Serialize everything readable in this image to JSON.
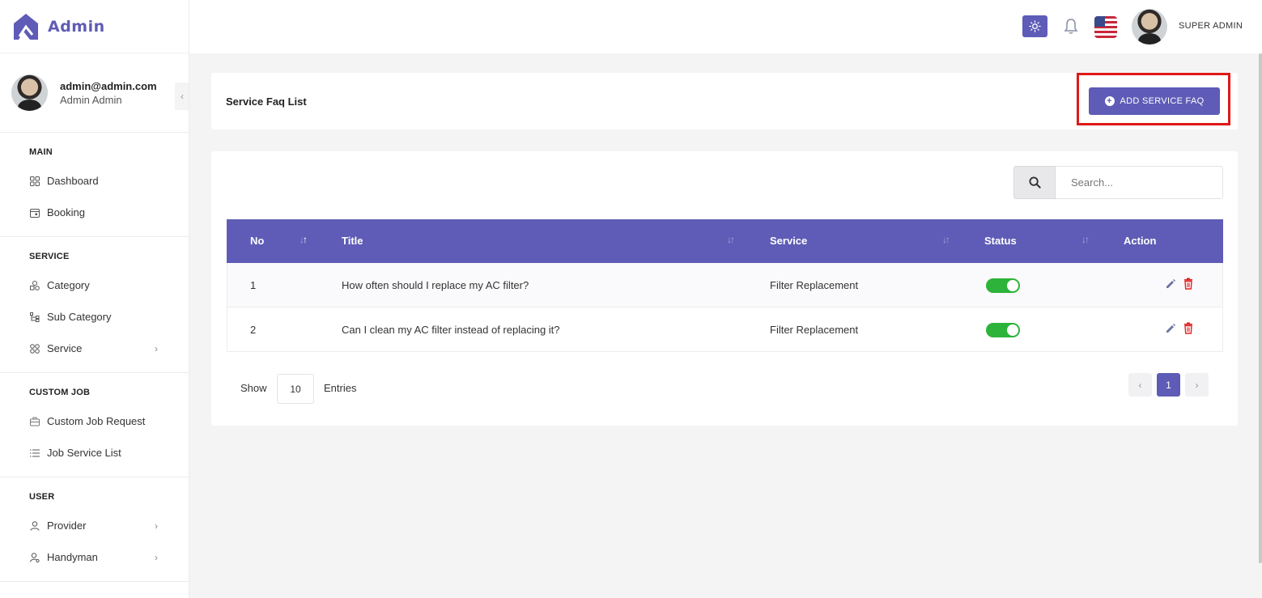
{
  "brand": {
    "name": "Admin"
  },
  "profile": {
    "email": "admin@admin.com",
    "role": "Admin Admin"
  },
  "sidebar": {
    "sections": [
      {
        "heading": "MAIN",
        "items": [
          {
            "label": "Dashboard",
            "icon": "grid-icon"
          },
          {
            "label": "Booking",
            "icon": "calendar-icon"
          }
        ]
      },
      {
        "heading": "SERVICE",
        "items": [
          {
            "label": "Category",
            "icon": "shapes-icon"
          },
          {
            "label": "Sub Category",
            "icon": "hierarchy-icon"
          },
          {
            "label": "Service",
            "icon": "apps-icon",
            "has_submenu": true
          }
        ]
      },
      {
        "heading": "CUSTOM JOB",
        "items": [
          {
            "label": "Custom Job Request",
            "icon": "briefcase-icon"
          },
          {
            "label": "Job Service List",
            "icon": "list-icon"
          }
        ]
      },
      {
        "heading": "USER",
        "items": [
          {
            "label": "Provider",
            "icon": "user-icon",
            "has_submenu": true
          },
          {
            "label": "Handyman",
            "icon": "user-gear-icon",
            "has_submenu": true
          }
        ]
      }
    ]
  },
  "header": {
    "user_name": "SUPER ADMIN",
    "theme_icon": "sun-icon",
    "notification_icon": "bell-icon",
    "language_flag": "us-flag"
  },
  "page": {
    "title": "Service Faq List",
    "add_button_label": "ADD SERVICE FAQ"
  },
  "search": {
    "placeholder": "Search..."
  },
  "table": {
    "columns": [
      "No",
      "Title",
      "Service",
      "Status",
      "Action"
    ],
    "rows": [
      {
        "no": "1",
        "title": "How often should I replace my AC filter?",
        "service": "Filter Replacement",
        "status": true
      },
      {
        "no": "2",
        "title": "Can I clean my AC filter instead of replacing it?",
        "service": "Filter Replacement",
        "status": true
      }
    ]
  },
  "pagination": {
    "show_label": "Show",
    "entries_value": "10",
    "entries_label": "Entries",
    "current_page": "1"
  },
  "colors": {
    "accent": "#5e5cb6",
    "toggle_on": "#2db33a",
    "delete": "#e02424",
    "highlight": "#e01818"
  }
}
